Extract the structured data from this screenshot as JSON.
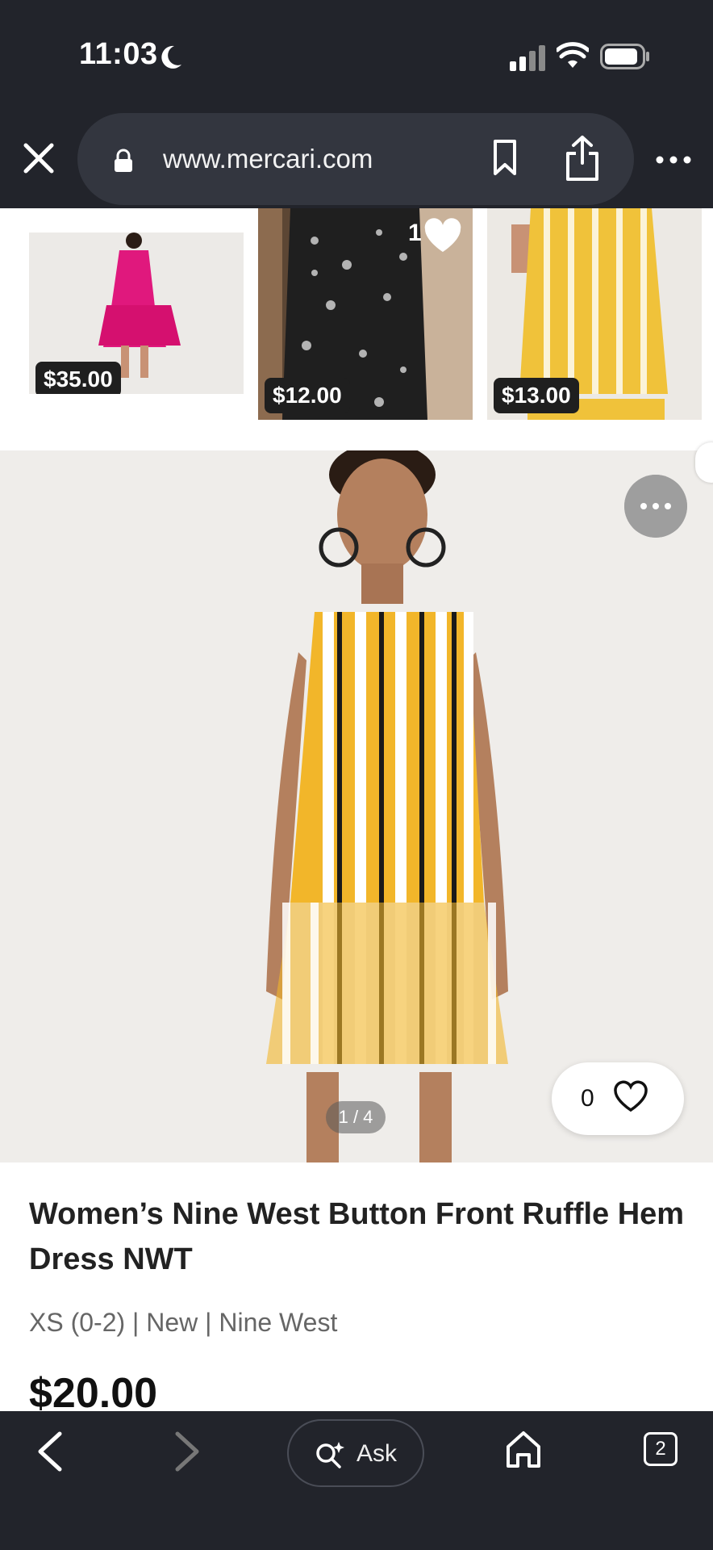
{
  "status_bar": {
    "time": "11:03"
  },
  "browser": {
    "url": "www.mercari.com"
  },
  "thumbnails": [
    {
      "price": "$35.00"
    },
    {
      "price": "$12.00",
      "likes": "1"
    },
    {
      "price": "$13.00"
    }
  ],
  "product": {
    "image_pager": "1 / 4",
    "likes": "0",
    "title": "Women’s Nine West Button Front Ruffle Hem Dress NWT",
    "meta": "XS (0-2) | New | Nine West",
    "price": "$20.00"
  },
  "toolbar": {
    "ask_label": "Ask",
    "tab_count": "2"
  }
}
